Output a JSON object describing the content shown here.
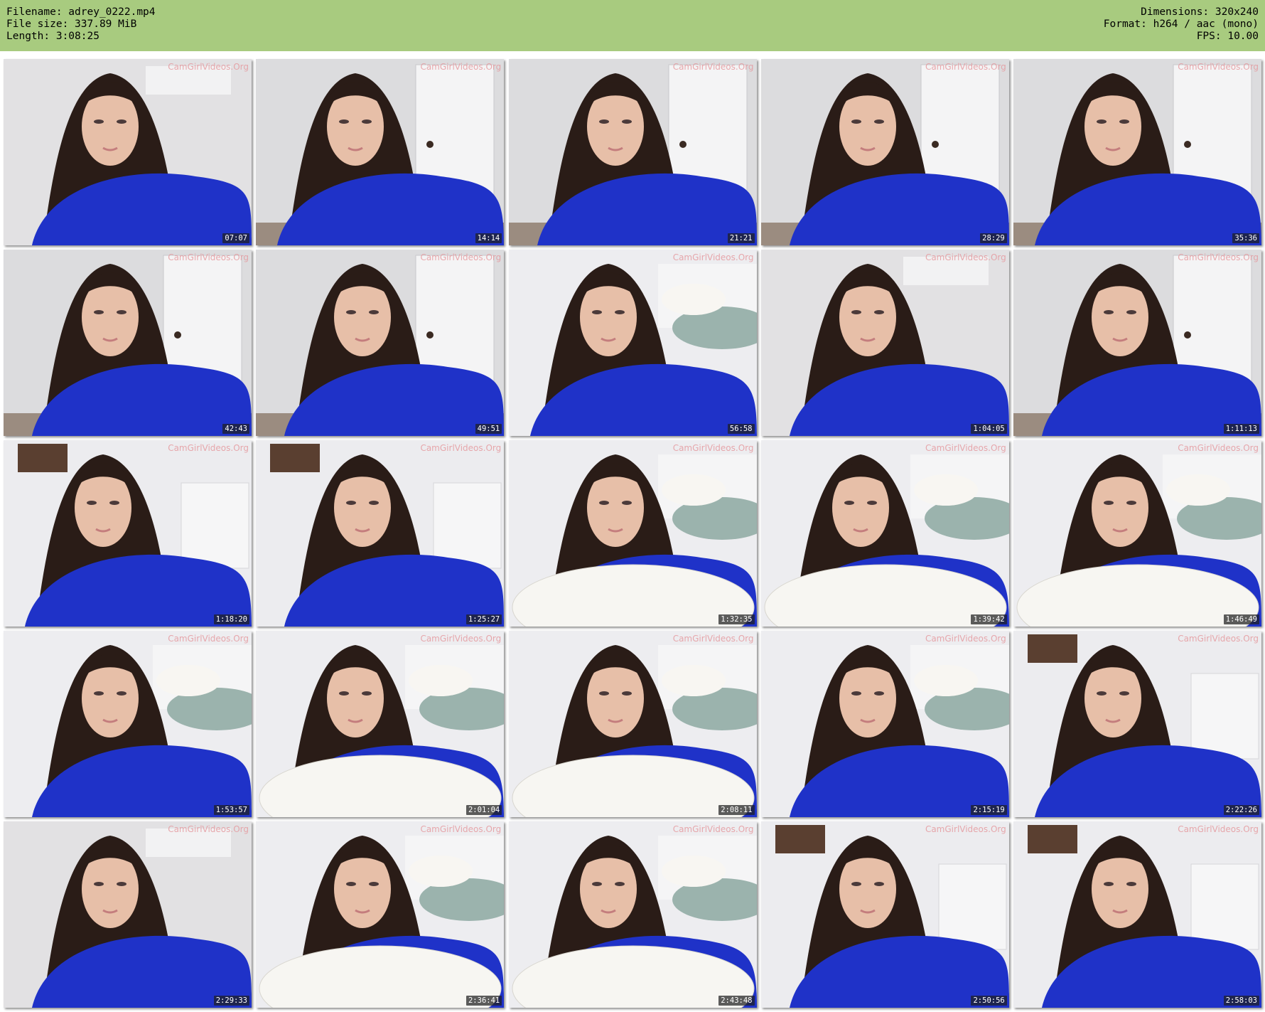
{
  "header": {
    "filename": "Filename: adrey_0222.mp4",
    "filesize": "File size: 337.89 MiB",
    "length": "Length: 3:08:25",
    "dimensions": "Dimensions: 320x240",
    "format": "Format: h264 / aac (mono)",
    "fps": "FPS: 10.00"
  },
  "watermark": "CamGirlVideos.Org",
  "colors": {
    "header_bg": "#a8cb7f",
    "shirt_blue": "#1f32c8",
    "hair": "#2a1c17",
    "skin": "#e7bfa8",
    "wall": "#e7e7e9",
    "pillow": "#f7f6f2"
  },
  "thumbnails": [
    {
      "time": "07:07",
      "scene": "shirt-near"
    },
    {
      "time": "14:14",
      "scene": "shirt-door"
    },
    {
      "time": "21:21",
      "scene": "shirt-door"
    },
    {
      "time": "28:29",
      "scene": "shirt-door"
    },
    {
      "time": "35:36",
      "scene": "shirt-door"
    },
    {
      "time": "42:43",
      "scene": "shirt-door"
    },
    {
      "time": "49:51",
      "scene": "shirt-door"
    },
    {
      "time": "56:58",
      "scene": "lying-bed"
    },
    {
      "time": "1:04:05",
      "scene": "shirt-near"
    },
    {
      "time": "1:11:13",
      "scene": "shirt-door"
    },
    {
      "time": "1:18:20",
      "scene": "shirt-wall"
    },
    {
      "time": "1:25:27",
      "scene": "shirt-wall"
    },
    {
      "time": "1:32:35",
      "scene": "pillow"
    },
    {
      "time": "1:39:42",
      "scene": "pillow"
    },
    {
      "time": "1:46:49",
      "scene": "pillow"
    },
    {
      "time": "1:53:57",
      "scene": "lying-bed"
    },
    {
      "time": "2:01:04",
      "scene": "pillow"
    },
    {
      "time": "2:08:11",
      "scene": "pillow"
    },
    {
      "time": "2:15:19",
      "scene": "lying-bed"
    },
    {
      "time": "2:22:26",
      "scene": "shirt-wall"
    },
    {
      "time": "2:29:33",
      "scene": "shirt-near"
    },
    {
      "time": "2:36:41",
      "scene": "pillow"
    },
    {
      "time": "2:43:48",
      "scene": "pillow"
    },
    {
      "time": "2:50:56",
      "scene": "shirt-wall"
    },
    {
      "time": "2:58:03",
      "scene": "shirt-wall"
    }
  ]
}
